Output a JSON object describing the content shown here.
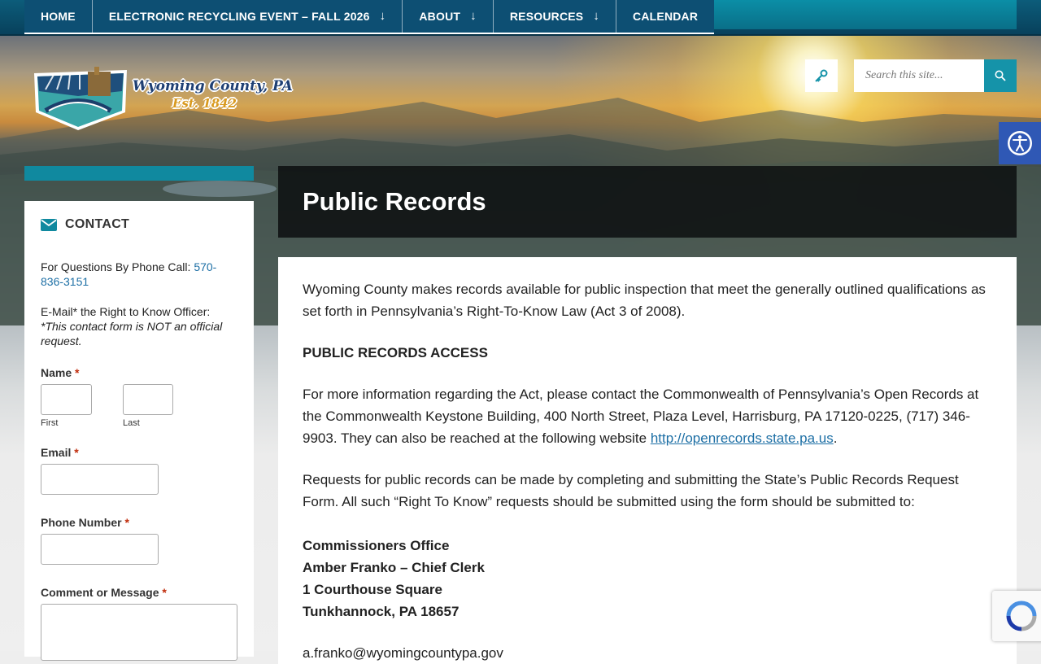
{
  "nav": {
    "items": [
      {
        "label": "HOME",
        "has_submenu": false
      },
      {
        "label": "ELECTRONIC RECYCLING EVENT – FALL 2026",
        "has_submenu": true
      },
      {
        "label": "ABOUT",
        "has_submenu": true
      },
      {
        "label": "RESOURCES",
        "has_submenu": true
      },
      {
        "label": "CALENDAR",
        "has_submenu": false
      }
    ],
    "submenu_glyph": "↓"
  },
  "logo": {
    "name": "Wyoming County, PA",
    "established": "Est. 1842"
  },
  "search": {
    "placeholder": "Search this site..."
  },
  "icons": {
    "key": "key-icon",
    "search": "search-icon",
    "accessibility": "accessibility-icon",
    "contact": "envelope-icon",
    "recaptcha": "recaptcha-icon"
  },
  "colors": {
    "nav_bg": "#0d4f73",
    "accent": "#10899f",
    "link": "#1d6fa5",
    "required": "#c02b0a",
    "accessibility_bg": "#2f58b5"
  },
  "sidebar": {
    "title": "CONTACT",
    "phone_prefix": "For Questions By Phone Call: ",
    "phone": "570-836-3151",
    "email_text": "E-Mail* the Right to Know Officer:",
    "email_note": "*This contact form is NOT an official request.",
    "form": {
      "required_mark": "*",
      "name_label": "Name",
      "first_label": "First",
      "last_label": "Last",
      "email_label": "Email",
      "phone_label": "Phone Number",
      "comment_label": "Comment or Message"
    }
  },
  "page": {
    "title": "Public Records",
    "intro": "Wyoming County makes records available for public inspection that meet the generally outlined qualifications as set forth in Pennsylvania’s Right-To-Know Law (Act 3 of 2008).",
    "access_heading": "PUBLIC RECORDS ACCESS",
    "info_text": "For more information regarding the Act, please contact the Commonwealth of Pennsylvania’s Open Records at the Commonwealth Keystone Building, 400 North Street, Plaza Level, Harrisburg, PA 17120-0225, (717) 346-9903.  They can also be reached at the following website ",
    "info_link": "http://openrecords.state.pa.us",
    "info_end": ".",
    "requests_text": "Requests for public records can be made by completing and submitting the State’s Public Records Request Form.  All such “Right To Know” requests should be submitted using the form should be submitted to:",
    "address": {
      "office": "Commissioners Office",
      "clerk": "Amber Franko – Chief Clerk",
      "street": "1 Courthouse Square",
      "city": "Tunkhannock, PA 18657"
    },
    "email_partial": "a.franko@wyomingcountypa.gov"
  }
}
